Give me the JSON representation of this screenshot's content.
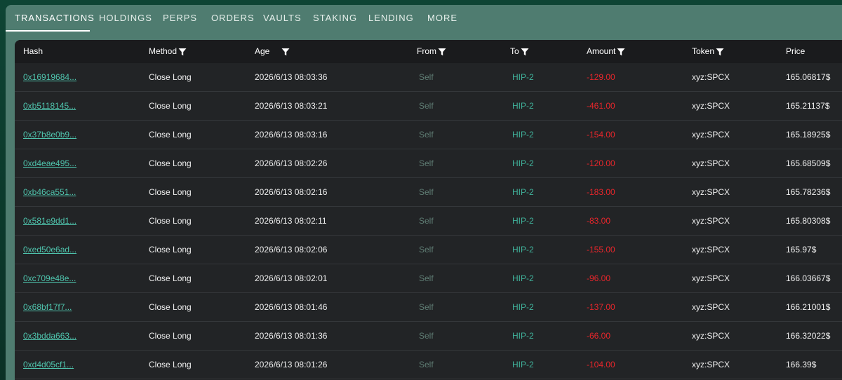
{
  "tabs": [
    {
      "label": "TRANSACTIONS",
      "active": true
    },
    {
      "label": "HOLDINGS"
    },
    {
      "label": "PERPS"
    },
    {
      "label": "ORDERS"
    },
    {
      "label": "VAULTS"
    },
    {
      "label": "STAKING"
    },
    {
      "label": "LENDING"
    },
    {
      "label": "MORE"
    }
  ],
  "columns": {
    "hash": "Hash",
    "method": "Method",
    "age": "Age",
    "from": "From",
    "to": "To",
    "amount": "Amount",
    "token": "Token",
    "price": "Price"
  },
  "colors": {
    "link": "#4fc4ad",
    "negative": "#e5262b",
    "muted": "#5f7d74",
    "tab_bar": "#4f7c70"
  },
  "icons": {
    "filter": "filter-icon"
  },
  "rows": [
    {
      "hash": "0x16919684...",
      "method": "Close Long",
      "age": "2026/6/13 08:03:36",
      "from": "Self",
      "to": "HIP-2",
      "amount": "-129.00",
      "token": "xyz:SPCX",
      "price": "165.06817$"
    },
    {
      "hash": "0xb5118145...",
      "method": "Close Long",
      "age": "2026/6/13 08:03:21",
      "from": "Self",
      "to": "HIP-2",
      "amount": "-461.00",
      "token": "xyz:SPCX",
      "price": "165.21137$"
    },
    {
      "hash": "0x37b8e0b9...",
      "method": "Close Long",
      "age": "2026/6/13 08:03:16",
      "from": "Self",
      "to": "HIP-2",
      "amount": "-154.00",
      "token": "xyz:SPCX",
      "price": "165.18925$"
    },
    {
      "hash": "0xd4eae495...",
      "method": "Close Long",
      "age": "2026/6/13 08:02:26",
      "from": "Self",
      "to": "HIP-2",
      "amount": "-120.00",
      "token": "xyz:SPCX",
      "price": "165.68509$"
    },
    {
      "hash": "0xb46ca551...",
      "method": "Close Long",
      "age": "2026/6/13 08:02:16",
      "from": "Self",
      "to": "HIP-2",
      "amount": "-183.00",
      "token": "xyz:SPCX",
      "price": "165.78236$"
    },
    {
      "hash": "0x581e9dd1...",
      "method": "Close Long",
      "age": "2026/6/13 08:02:11",
      "from": "Self",
      "to": "HIP-2",
      "amount": "-83.00",
      "token": "xyz:SPCX",
      "price": "165.80308$"
    },
    {
      "hash": "0xed50e6ad...",
      "method": "Close Long",
      "age": "2026/6/13 08:02:06",
      "from": "Self",
      "to": "HIP-2",
      "amount": "-155.00",
      "token": "xyz:SPCX",
      "price": "165.97$"
    },
    {
      "hash": "0xc709e48e...",
      "method": "Close Long",
      "age": "2026/6/13 08:02:01",
      "from": "Self",
      "to": "HIP-2",
      "amount": "-96.00",
      "token": "xyz:SPCX",
      "price": "166.03667$"
    },
    {
      "hash": "0x68bf17f7...",
      "method": "Close Long",
      "age": "2026/6/13 08:01:46",
      "from": "Self",
      "to": "HIP-2",
      "amount": "-137.00",
      "token": "xyz:SPCX",
      "price": "166.21001$"
    },
    {
      "hash": "0x3bdda663...",
      "method": "Close Long",
      "age": "2026/6/13 08:01:36",
      "from": "Self",
      "to": "HIP-2",
      "amount": "-66.00",
      "token": "xyz:SPCX",
      "price": "166.32022$"
    },
    {
      "hash": "0xd4d05cf1...",
      "method": "Close Long",
      "age": "2026/6/13 08:01:26",
      "from": "Self",
      "to": "HIP-2",
      "amount": "-104.00",
      "token": "xyz:SPCX",
      "price": "166.39$"
    }
  ]
}
